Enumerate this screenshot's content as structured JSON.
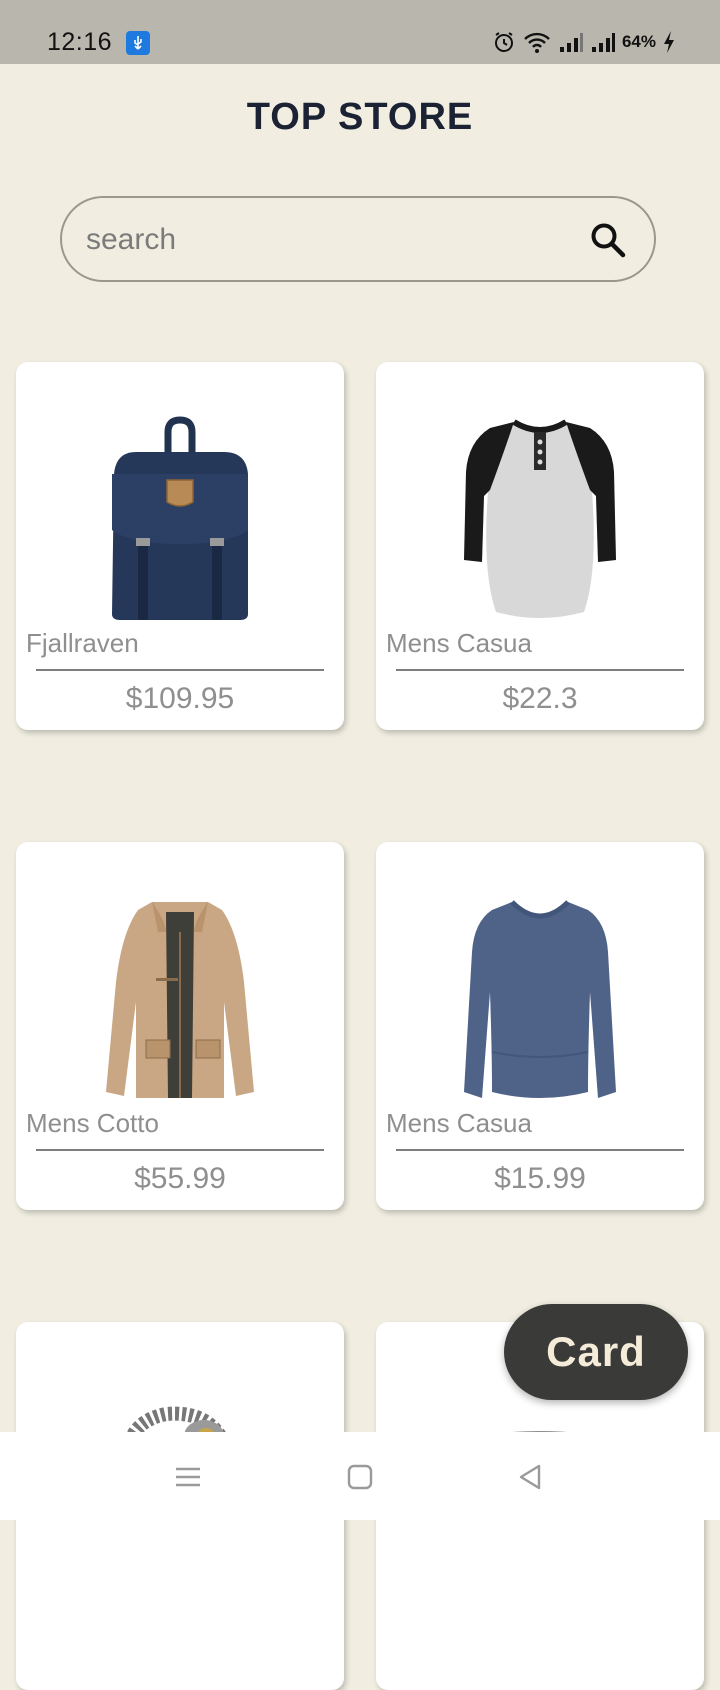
{
  "status_bar": {
    "time": "12:16",
    "battery": "64%",
    "icons": [
      "usb-icon",
      "alarm-icon",
      "wifi-icon",
      "signal-icon",
      "signal-icon",
      "charging-icon"
    ]
  },
  "header": {
    "title": "TOP STORE"
  },
  "search": {
    "placeholder": "search",
    "value": "",
    "icon": "search-icon"
  },
  "products": [
    {
      "name": "Fjallraven",
      "price": "$109.95",
      "image": "backpack"
    },
    {
      "name": "Mens Casua",
      "price": "$22.3",
      "image": "raglan-tshirt"
    },
    {
      "name": "Mens Cotto",
      "price": "$55.99",
      "image": "khaki-jacket"
    },
    {
      "name": "Mens Casua",
      "price": "$15.99",
      "image": "blue-long-sleeve"
    },
    {
      "name": "",
      "price": "",
      "image": "chain-bracelet"
    },
    {
      "name": "",
      "price": "",
      "image": "silver-ring"
    }
  ],
  "fab": {
    "label": "Card"
  },
  "nav": {
    "icons": [
      "menu-icon",
      "home-icon",
      "back-icon"
    ]
  },
  "colors": {
    "background": "#f1eee1",
    "title": "#1a2233",
    "fab": "#3a3a38",
    "fab_text": "#f4ecd9"
  }
}
